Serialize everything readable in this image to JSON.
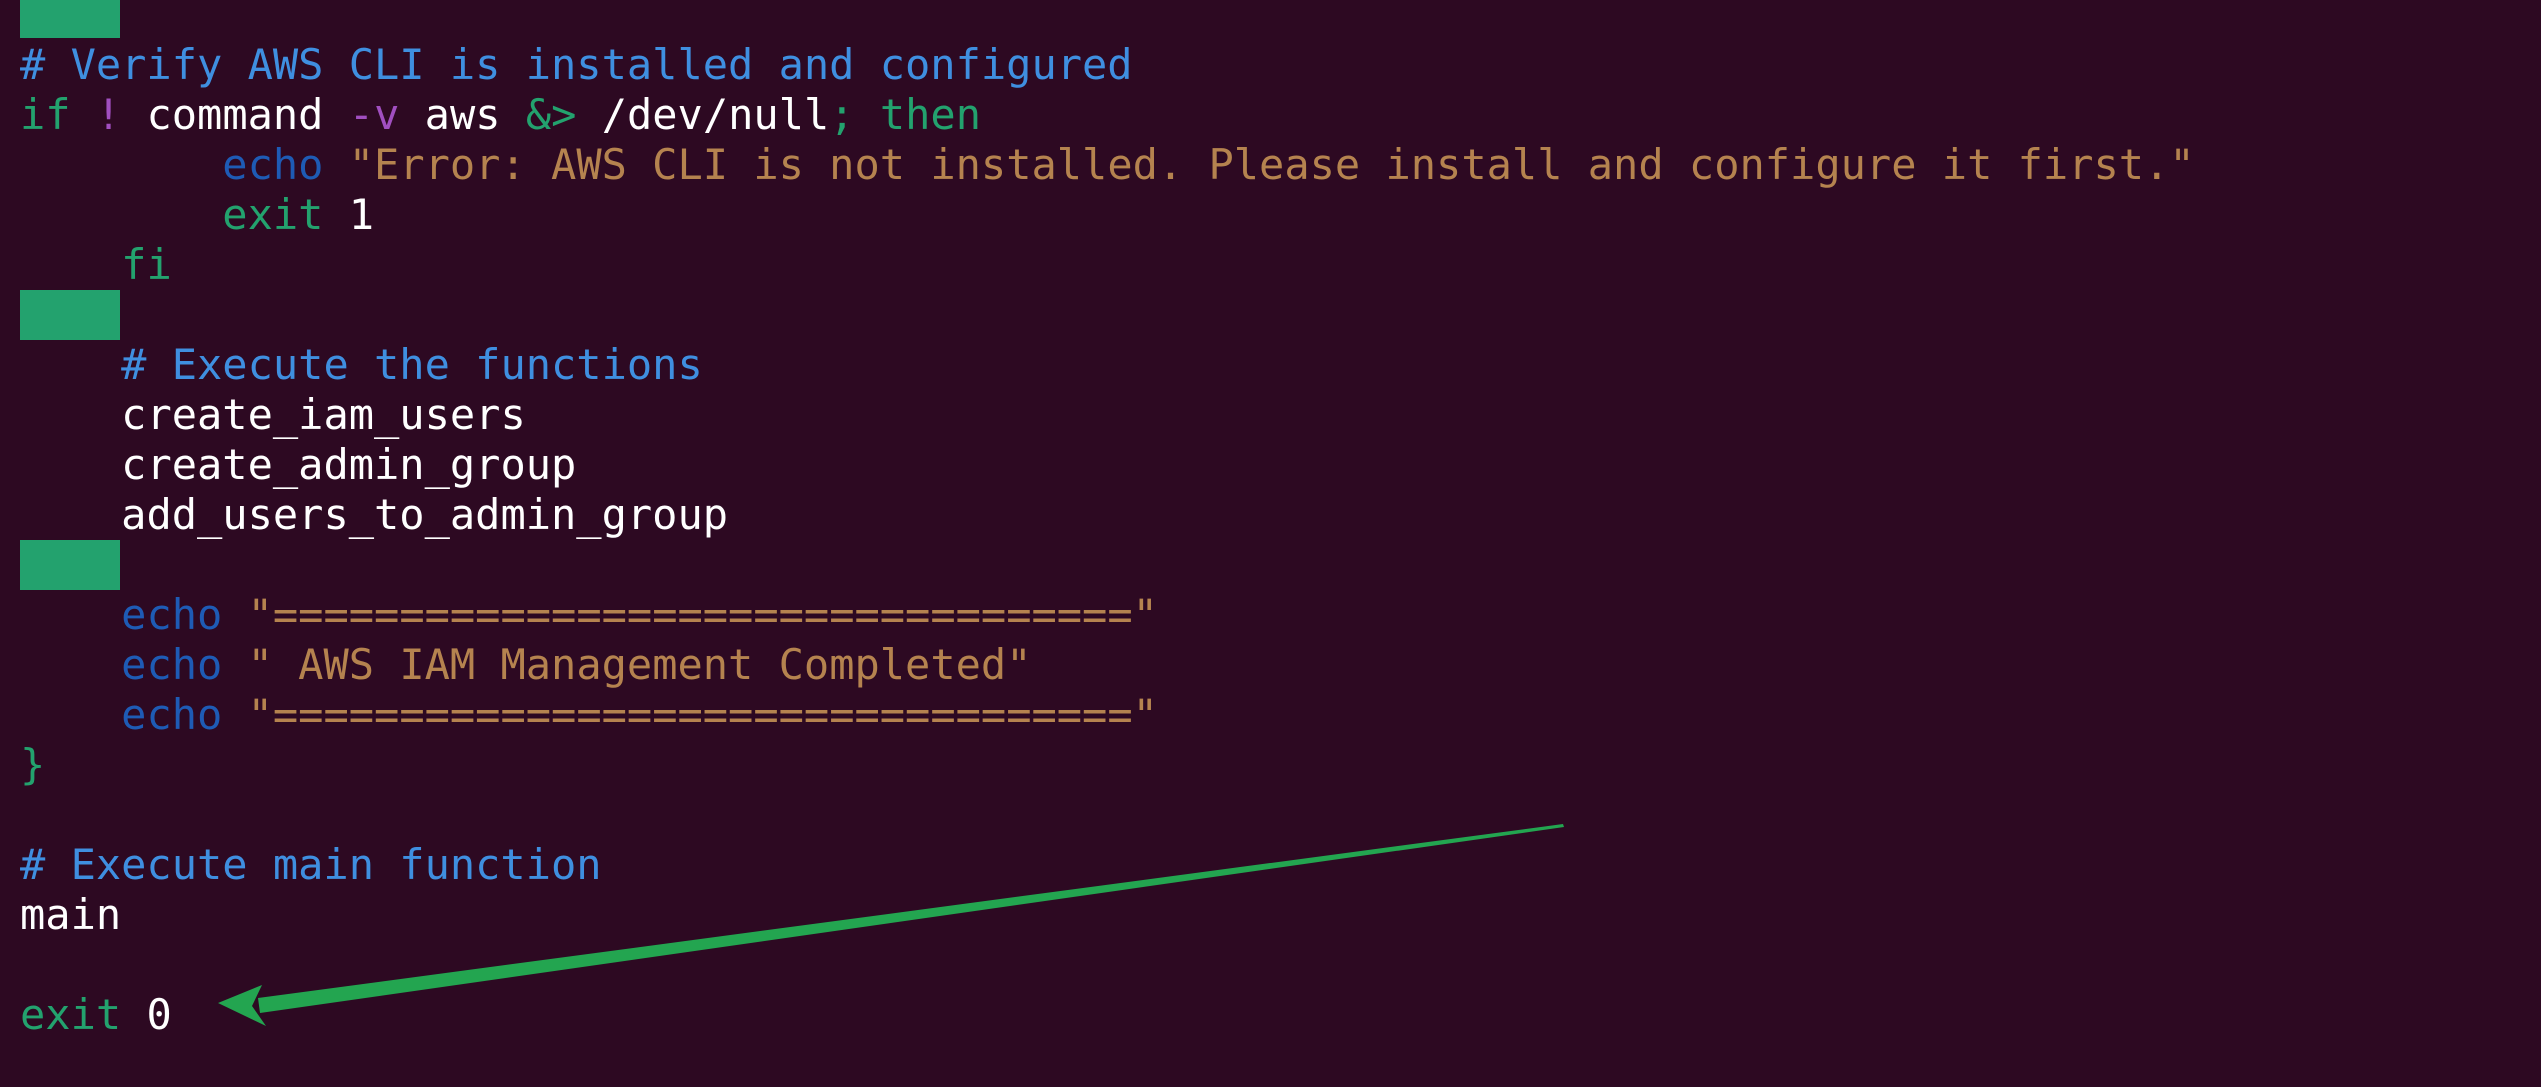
{
  "colors": {
    "background": "#2d0922",
    "comment": "#3f8fe0",
    "keyword": "#23a26e",
    "operator": "#a14fc0",
    "plain": "#ffffff",
    "string": "#b5834f",
    "builtin": "#1e5bb5",
    "cursor_block": "#23a26e",
    "arrow": "#23a550"
  },
  "code": {
    "verify_comment": "# Verify AWS CLI is installed and configured",
    "if_kw": "if",
    "not_op": "!",
    "command_word": "command",
    "flag_v": "-v",
    "aws_word": "aws",
    "redirect_op": "&>",
    "dev_null": "/dev/null",
    "semicolon": ";",
    "then_kw": "then",
    "echo_kw": "echo",
    "error_string": "\"Error: AWS CLI is not installed. Please install and configure it first.\"",
    "exit_kw": "exit",
    "exit_one": "1",
    "fi_kw": "fi",
    "execute_functions_comment": "# Execute the functions",
    "create_users_call": "create_iam_users",
    "create_group_call": "create_admin_group",
    "add_users_call": "add_users_to_admin_group",
    "separator_string": "\"==================================\"",
    "completed_string": "\" AWS IAM Management Completed\"",
    "closing_brace": "}",
    "execute_main_comment": "# Execute main function",
    "main_call": "main",
    "exit_zero": "0"
  }
}
